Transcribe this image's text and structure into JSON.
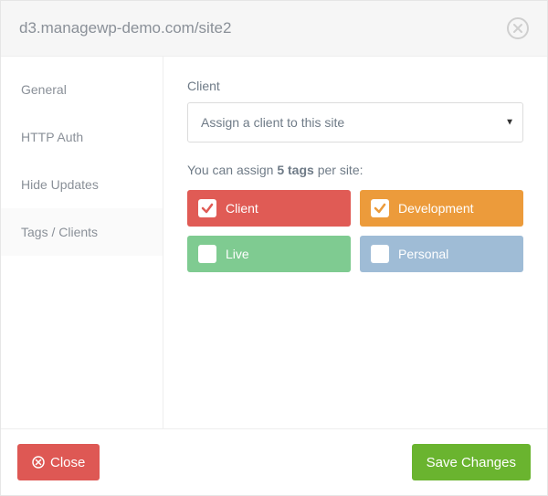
{
  "header": {
    "title": "d3.managewp-demo.com/site2"
  },
  "sidebar": {
    "items": [
      {
        "label": "General"
      },
      {
        "label": "HTTP Auth"
      },
      {
        "label": "Hide Updates"
      },
      {
        "label": "Tags / Clients"
      }
    ],
    "activeIndex": 3
  },
  "client": {
    "label": "Client",
    "placeholder": "Assign a client to this site"
  },
  "tags": {
    "hint_prefix": "You can assign ",
    "hint_bold": "5 tags",
    "hint_suffix": " per site:",
    "items": [
      {
        "label": "Client",
        "colorClass": "tag-red",
        "checked": true,
        "checkColor": "#e05b55"
      },
      {
        "label": "Development",
        "colorClass": "tag-orange",
        "checked": true,
        "checkColor": "#ec9b3b"
      },
      {
        "label": "Live",
        "colorClass": "tag-green",
        "checked": false,
        "checkColor": "#7fcb91"
      },
      {
        "label": "Personal",
        "colorClass": "tag-blue",
        "checked": false,
        "checkColor": "#9fbcd6"
      }
    ]
  },
  "footer": {
    "close_label": "Close",
    "save_label": "Save Changes"
  }
}
